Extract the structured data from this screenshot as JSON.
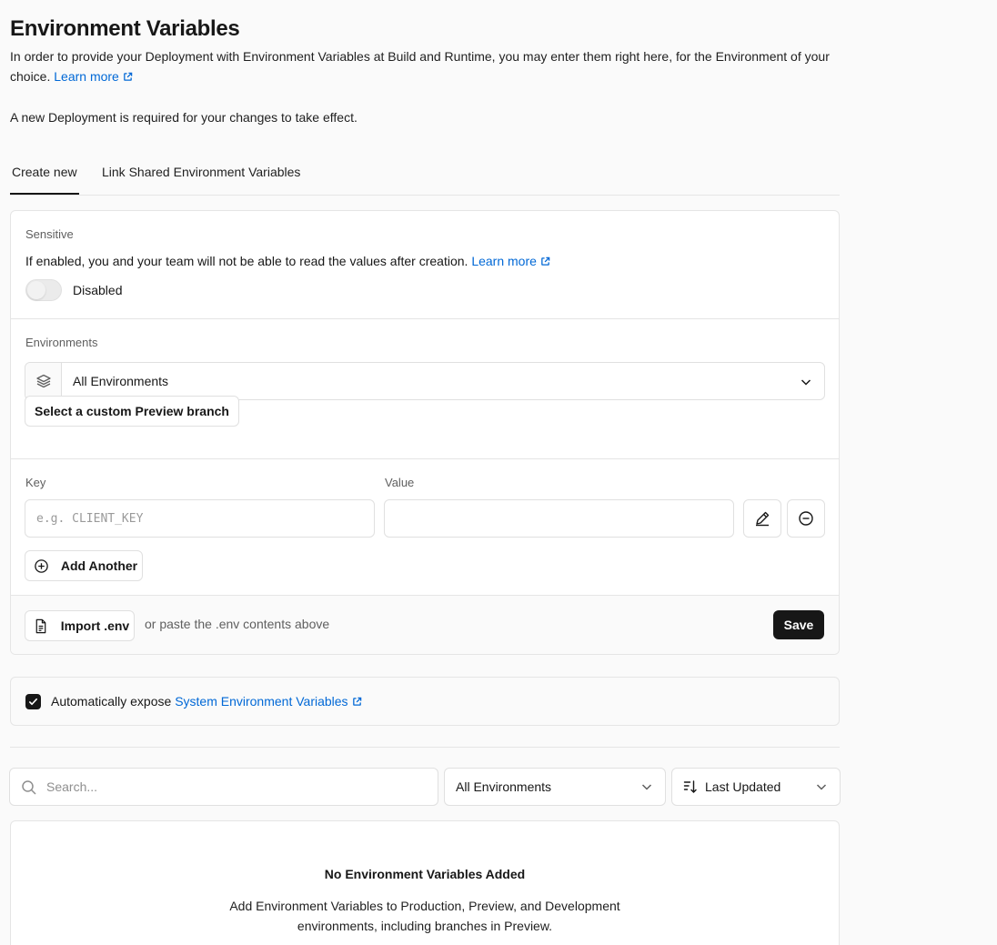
{
  "header": {
    "title": "Environment Variables",
    "description": "In order to provide your Deployment with Environment Variables at Build and Runtime, you may enter them right here, for the Environment of your choice.",
    "learn_more": "Learn more",
    "note": "A new Deployment is required for your changes to take effect."
  },
  "tabs": [
    {
      "label": "Create new",
      "active": true
    },
    {
      "label": "Link Shared Environment Variables",
      "active": false
    }
  ],
  "sensitive": {
    "label": "Sensitive",
    "description": "If enabled, you and your team will not be able to read the values after creation.",
    "learn_more": "Learn more",
    "toggle_state": "Disabled"
  },
  "environments": {
    "label": "Environments",
    "selected": "All Environments",
    "branch_button": "Select a custom Preview branch"
  },
  "key_value": {
    "key_label": "Key",
    "key_placeholder": "e.g. CLIENT_KEY",
    "value_label": "Value",
    "value": "",
    "add_another": "Add Another"
  },
  "footer": {
    "import_button": "Import .env",
    "hint": "or paste the .env contents above",
    "save": "Save"
  },
  "auto_expose": {
    "checked": true,
    "text": "Automatically expose",
    "link": "System Environment Variables"
  },
  "filters": {
    "search_placeholder": "Search...",
    "environment": "All Environments",
    "sort": "Last Updated"
  },
  "empty_state": {
    "title": "No Environment Variables Added",
    "description": "Add Environment Variables to Production, Preview, and Development environments, including branches in Preview."
  },
  "colors": {
    "link": "#0068d6",
    "primary": "#171717",
    "border": "#e5e5e5"
  }
}
